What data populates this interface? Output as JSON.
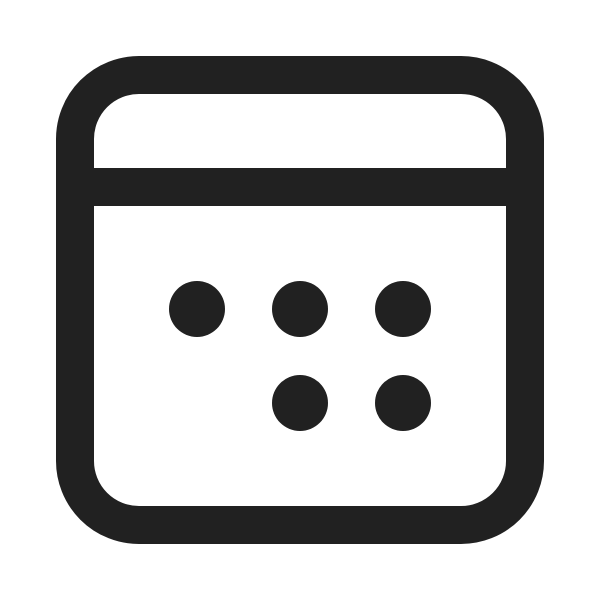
{
  "icon": {
    "name": "calendar-icon",
    "stroke_color": "#212121",
    "background": "#ffffff"
  }
}
